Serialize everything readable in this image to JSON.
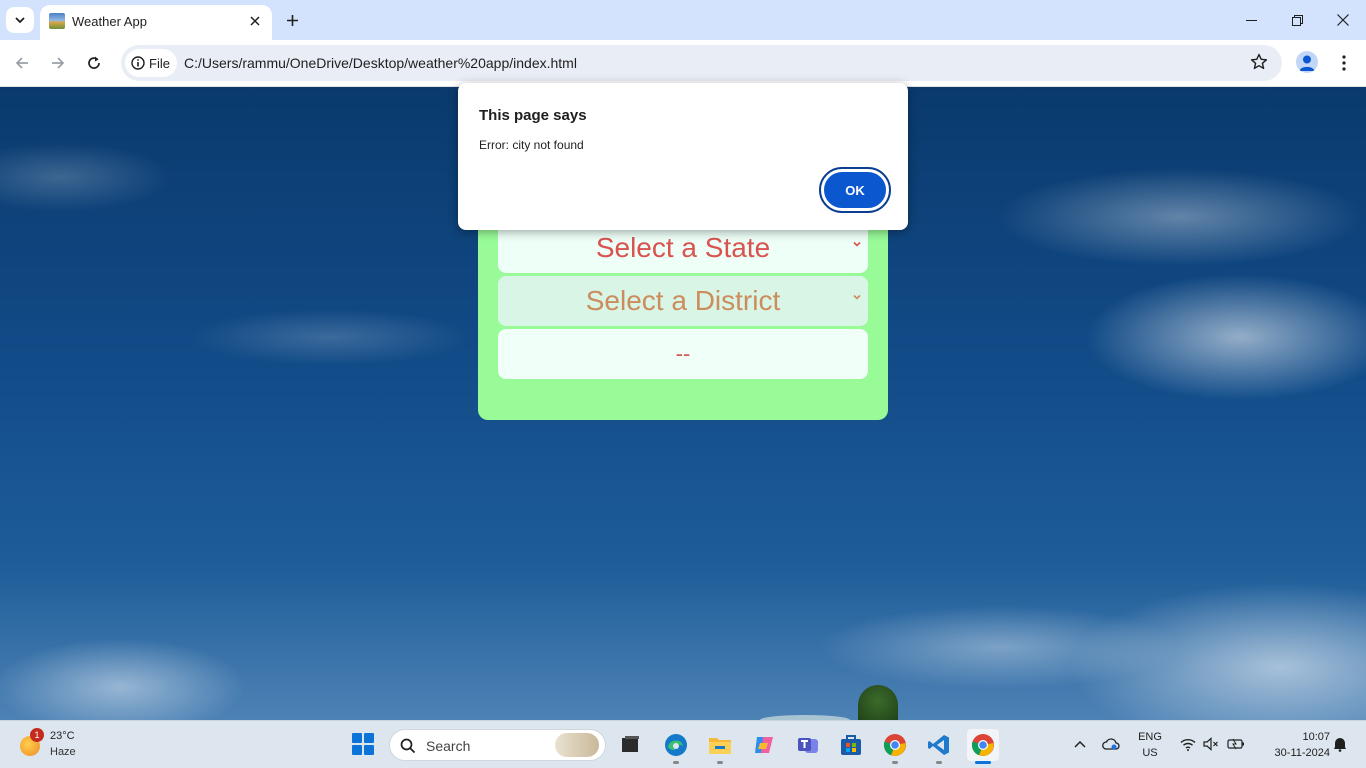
{
  "browser": {
    "tab_title": "Weather App",
    "site_chip_label": "File",
    "url": "C:/Users/rammu/OneDrive/Desktop/weather%20app/index.html"
  },
  "page": {
    "state_select": "Select a State",
    "district_select": "Select a District",
    "result": "--"
  },
  "dialog": {
    "title": "This page says",
    "message": "Error: city not found",
    "ok_label": "OK"
  },
  "taskbar": {
    "weather_badge": "1",
    "weather_temp": "23°C",
    "weather_condition": "Haze",
    "search_label": "Search",
    "language_top": "ENG",
    "language_bottom": "US",
    "time": "10:07",
    "date": "30-11-2024",
    "apps": [
      "task-view",
      "edge",
      "file-explorer",
      "copilot",
      "teams",
      "store",
      "chrome",
      "vscode",
      "chrome-active"
    ]
  },
  "colors": {
    "card_bg": "#98fb98",
    "state_text": "#d9534f",
    "district_text": "#cd8c5c",
    "ok_button": "#0b57d0",
    "tabstrip": "#d3e3fd"
  }
}
